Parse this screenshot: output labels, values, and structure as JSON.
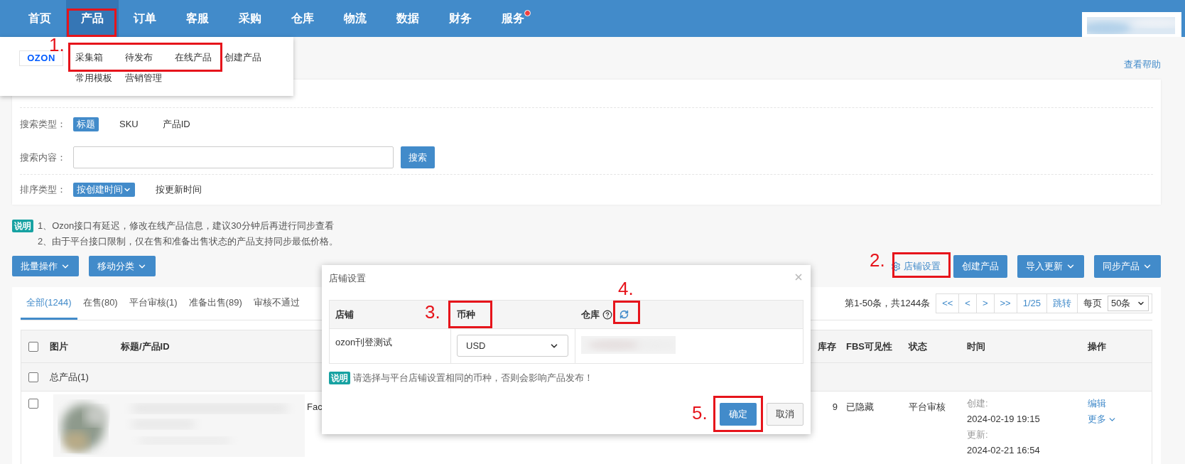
{
  "nav": {
    "items": [
      {
        "label": "首页",
        "selected": false,
        "badge": false
      },
      {
        "label": "产品",
        "selected": true,
        "badge": false
      },
      {
        "label": "订单",
        "selected": false,
        "badge": false
      },
      {
        "label": "客服",
        "selected": false,
        "badge": false
      },
      {
        "label": "采购",
        "selected": false,
        "badge": false
      },
      {
        "label": "仓库",
        "selected": false,
        "badge": false
      },
      {
        "label": "物流",
        "selected": false,
        "badge": false
      },
      {
        "label": "数据",
        "selected": false,
        "badge": false
      },
      {
        "label": "财务",
        "selected": false,
        "badge": false
      },
      {
        "label": "服务",
        "selected": false,
        "badge": true
      }
    ]
  },
  "menu": {
    "logo": "OZON",
    "rows": [
      [
        "采集箱",
        "待发布",
        "在线产品",
        "创建产品"
      ],
      [
        "常用模板",
        "营销管理"
      ]
    ]
  },
  "help_link": "查看帮助",
  "filters": [
    {
      "label": "搜索类型：",
      "kind": "options",
      "options": [
        {
          "label": "标题",
          "selected": true
        },
        {
          "label": "SKU",
          "selected": false
        },
        {
          "label": "产品ID",
          "selected": false
        }
      ]
    },
    {
      "label": "搜索内容：",
      "kind": "search",
      "button": "搜索"
    },
    {
      "label": "排序类型：",
      "kind": "sort",
      "options": [
        {
          "label": "按创建时间",
          "selected": true
        },
        {
          "label": "按更新时间",
          "selected": false
        }
      ]
    }
  ],
  "notice": {
    "tag": "说明",
    "lines": [
      "1、Ozon接口有延迟，修改在线产品信息，建议30分钟后再进行同步查看",
      "2、由于平台接口限制，仅在售和准备出售状态的产品支持同步最低价格。"
    ]
  },
  "toolbar": {
    "left": [
      {
        "label": "批量操作"
      },
      {
        "label": "移动分类"
      }
    ],
    "settings_link": "店铺设置",
    "right": [
      {
        "label": "创建产品",
        "dropdown": false
      },
      {
        "label": "导入更新",
        "dropdown": true
      },
      {
        "label": "同步产品",
        "dropdown": true
      }
    ]
  },
  "tabs": [
    {
      "label": "全部(1244)",
      "selected": true
    },
    {
      "label": "在售(80)",
      "selected": false
    },
    {
      "label": "平台审核(1)",
      "selected": false
    },
    {
      "label": "准备出售(89)",
      "selected": false
    },
    {
      "label": "审核不通过",
      "selected": false
    }
  ],
  "pagination": {
    "summary": "第1-50条，共1244条",
    "buttons": [
      "<<",
      "<",
      ">",
      ">>"
    ],
    "page": "1/25",
    "jump": "跳转",
    "per_page_label": "每页",
    "per_page": "50条"
  },
  "table": {
    "header_checked": false,
    "columns": [
      "图片",
      "标题/产品ID",
      "库存",
      "FBS可见性",
      "状态",
      "时间",
      "操作"
    ],
    "group": {
      "label": "总产品(1)",
      "checked": false
    },
    "rows": [
      {
        "checked": false,
        "title": "Fac",
        "stock": "9",
        "fbs": "已隐藏",
        "status": "平台审核",
        "created_label": "创建:",
        "created": "2024-02-19 19:15",
        "updated_label": "更新:",
        "updated": "2024-02-21 16:54",
        "actions": [
          {
            "label": "编辑",
            "dropdown": false
          },
          {
            "label": "更多",
            "dropdown": true
          }
        ]
      }
    ]
  },
  "dialog": {
    "title": "店铺设置",
    "columns": [
      "店铺",
      "币种",
      "仓库"
    ],
    "rows": [
      {
        "shop": "ozon刊登测试",
        "currency": "USD"
      }
    ],
    "note_tag": "说明",
    "note": "请选择与平台店铺设置相同的币种，否则会影响产品发布！",
    "buttons": [
      {
        "label": "确定",
        "primary": true
      },
      {
        "label": "取消",
        "primary": false
      }
    ]
  },
  "annotations": [
    {
      "label": "1."
    },
    {
      "label": "2."
    },
    {
      "label": "3."
    },
    {
      "label": "4."
    },
    {
      "label": "5."
    }
  ]
}
